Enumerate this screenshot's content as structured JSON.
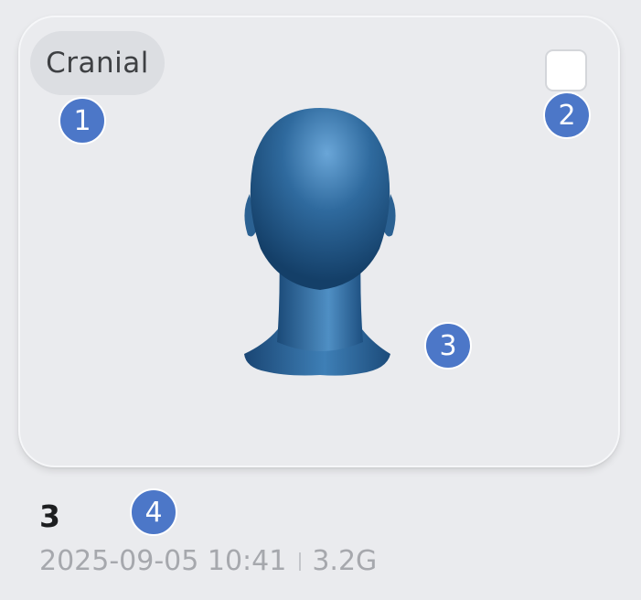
{
  "card": {
    "tag_label": "Cranial",
    "checkbox_checked": false,
    "model_icon": "head-3d-model-icon"
  },
  "markers": [
    "1",
    "2",
    "3",
    "4"
  ],
  "item": {
    "title": "3",
    "timestamp": "2025-09-05 10:41",
    "size": "3.2G"
  },
  "colors": {
    "background": "#eaebee",
    "marker": "#4c77c8",
    "model": "#2e6496",
    "title": "#1d1e20",
    "meta": "#a6a8ad"
  }
}
